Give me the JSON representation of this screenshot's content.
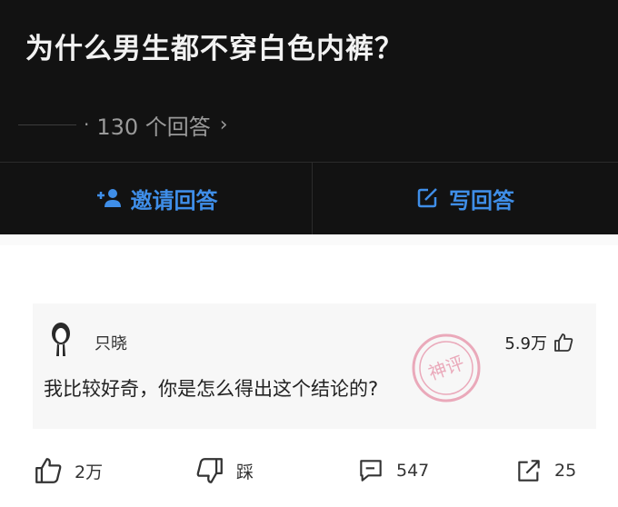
{
  "question": {
    "title": "为什么男生都不穿白色内裤？",
    "answers_count": "130 个回答"
  },
  "actions": {
    "invite_label": "邀请回答",
    "write_label": "写回答"
  },
  "comment": {
    "author": "只晓",
    "likes": "5.9万",
    "text": "我比较好奇，你是怎么得出这个结论的?",
    "stamp_text": "神评"
  },
  "footer": {
    "upvotes": "2万",
    "downvote_label": "踩",
    "comments": "547",
    "shares": "25"
  },
  "colors": {
    "accent": "#3f8ee8",
    "dark_bg": "#121212",
    "stamp": "#e06a8a"
  }
}
